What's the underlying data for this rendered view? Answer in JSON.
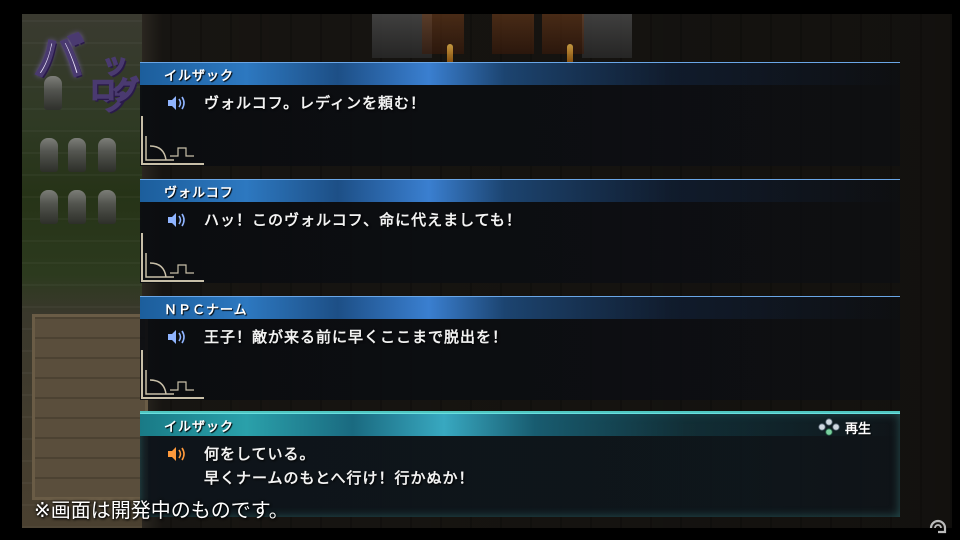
{
  "title": {
    "main": "バ",
    "line1": "ック",
    "line2": "ログ"
  },
  "entries": [
    {
      "speaker": "イルザック",
      "lines": [
        "ヴォルコフ。レディンを頼む！"
      ],
      "selected": false
    },
    {
      "speaker": "ヴォルコフ",
      "lines": [
        "ハッ！このヴォルコフ、命に代えましても！"
      ],
      "selected": false
    },
    {
      "speaker": "ＮＰＣナーム",
      "lines": [
        "王子！敵が来る前に早くここまで脱出を！"
      ],
      "selected": false
    },
    {
      "speaker": "イルザック",
      "lines": [
        "何をしている。",
        "早くナームのもとへ行け！行かぬか！"
      ],
      "selected": true
    }
  ],
  "replay": {
    "label": "再生"
  },
  "notice": "※画面は開発中のものです。",
  "colors": {
    "name_bar": "#2d78c0",
    "selected_accent": "#4fc6c0",
    "voice_icon": "#8fb4ff",
    "voice_icon_active": "#ff9a3c"
  }
}
